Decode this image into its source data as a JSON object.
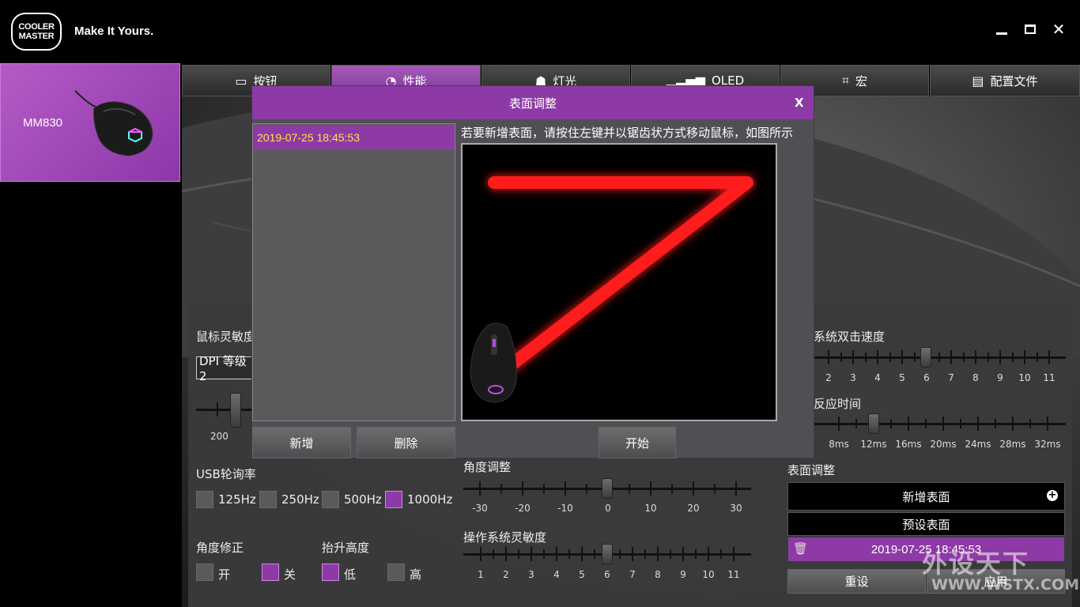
{
  "header": {
    "logo_line1": "COOLER",
    "logo_line2": "MASTER",
    "tagline": "Make It Yours.",
    "minimize": "minimize-icon",
    "maximize": "maximize-icon",
    "close": "close-icon"
  },
  "device": {
    "name": "MM830"
  },
  "tabs": [
    {
      "label": "按钮",
      "icon": "mouse-icon"
    },
    {
      "label": "性能",
      "icon": "gauge-icon"
    },
    {
      "label": "灯光",
      "icon": "bulb-icon"
    },
    {
      "label": "OLED",
      "icon": "equalizer-icon"
    },
    {
      "label": "宏",
      "icon": "macro-icon"
    },
    {
      "label": "配置文件",
      "icon": "folder-icon"
    }
  ],
  "performance": {
    "sensitivity_label": "鼠标灵敏度",
    "dpi_select": "DPI 等级2",
    "dpi_value": "200",
    "usb_label": "USB轮询率",
    "usb_options": [
      "125Hz",
      "250Hz",
      "500Hz",
      "1000Hz"
    ],
    "usb_selected": "1000Hz",
    "angle_fix_label": "角度修正",
    "angle_fix_on": "开",
    "angle_fix_off": "关",
    "lift_label": "抬升高度",
    "lift_low": "低",
    "lift_high": "高",
    "angle_adjust_label": "角度调整",
    "angle_ticks": [
      "-30",
      "-20",
      "-10",
      "0",
      "10",
      "20",
      "30"
    ],
    "angle_value": 0,
    "os_sens_label": "操作系统灵敏度",
    "os_ticks": [
      "1",
      "2",
      "3",
      "4",
      "5",
      "6",
      "7",
      "8",
      "9",
      "10",
      "11"
    ],
    "os_value": 6,
    "dblclick_label": "系统双击速度",
    "dblclick_ticks": [
      "2",
      "3",
      "4",
      "5",
      "6",
      "7",
      "8",
      "9",
      "10",
      "11"
    ],
    "dblclick_value": 6,
    "response_label": "反应时间",
    "response_ticks": [
      "8ms",
      "12ms",
      "16ms",
      "20ms",
      "24ms",
      "28ms",
      "32ms"
    ],
    "response_value": "12ms",
    "surface_label": "表面调整",
    "add_surface": "新增表面",
    "preset_surface": "预设表面",
    "surface_entry": "2019-07-25 18:45:53",
    "reset": "重设",
    "apply": "应用"
  },
  "dialog": {
    "title": "表面调整",
    "close": "X",
    "list_item": "2019-07-25 18:45:53",
    "instruction": "若要新增表面，请按住左键并以锯齿状方式移动鼠标，如图所示",
    "add": "新增",
    "delete": "删除",
    "start": "开始"
  },
  "watermark": {
    "line1": "外设天下",
    "line2": "WWW.WSTX.COM"
  },
  "colors": {
    "accent": "#8e3aa6",
    "selected_text": "#ffe14a",
    "trace": "#ff1a1a"
  }
}
